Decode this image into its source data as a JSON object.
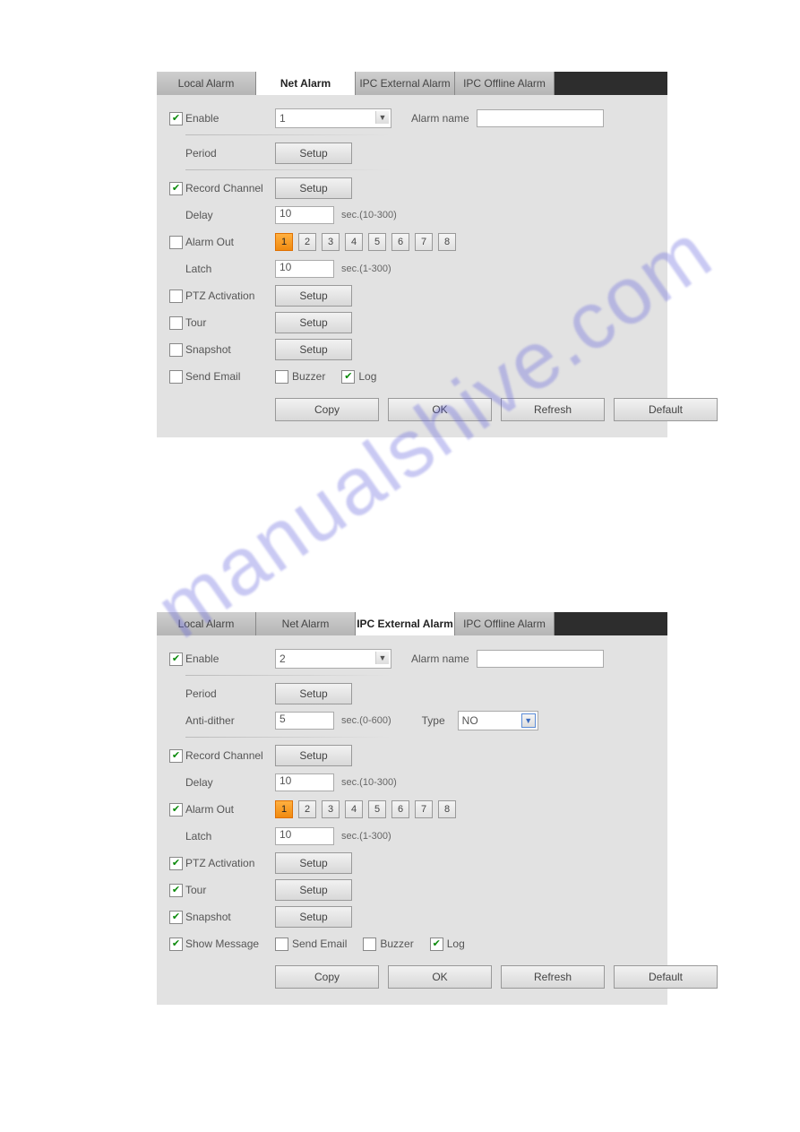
{
  "watermark": "manualshive.com",
  "tabs": {
    "t0": "Local Alarm",
    "t1": "Net Alarm",
    "t2": "IPC External Alarm",
    "t3": "IPC Offline Alarm"
  },
  "common": {
    "enable": "Enable",
    "alarm_name": "Alarm name",
    "period": "Period",
    "anti_dither": "Anti-dither",
    "type": "Type",
    "record_channel": "Record Channel",
    "delay": "Delay",
    "alarm_out": "Alarm Out",
    "latch": "Latch",
    "ptz": "PTZ Activation",
    "tour": "Tour",
    "snapshot": "Snapshot",
    "show_message": "Show Message",
    "send_email": "Send Email",
    "buzzer": "Buzzer",
    "log": "Log",
    "setup": "Setup",
    "sec_10_300": "sec.(10-300)",
    "sec_1_300": "sec.(1-300)",
    "sec_0_600": "sec.(0-600)",
    "copy": "Copy",
    "ok": "OK",
    "refresh": "Refresh",
    "default": "Default",
    "type_val": "NO"
  },
  "panel1": {
    "channel": "1",
    "delay_val": "10",
    "latch_val": "10",
    "outs": [
      "1",
      "2",
      "3",
      "4",
      "5",
      "6",
      "7",
      "8"
    ]
  },
  "panel2": {
    "channel": "2",
    "anti_val": "5",
    "delay_val": "10",
    "latch_val": "10",
    "outs": [
      "1",
      "2",
      "3",
      "4",
      "5",
      "6",
      "7",
      "8"
    ]
  }
}
